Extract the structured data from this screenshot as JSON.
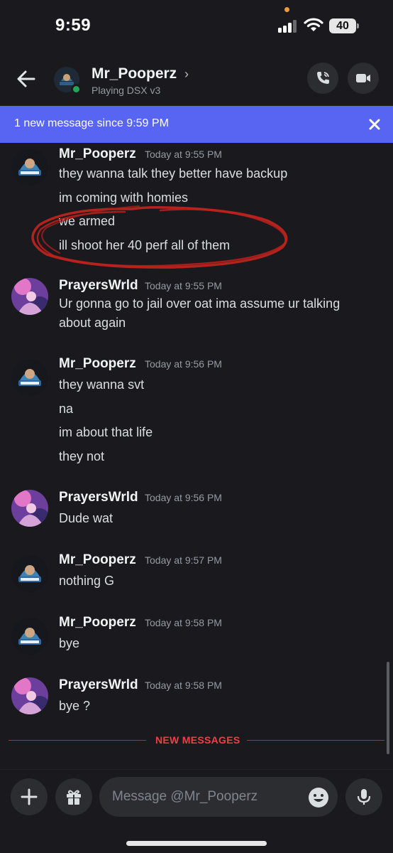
{
  "status_bar": {
    "time": "9:59",
    "battery": "40"
  },
  "header": {
    "name": "Mr_Pooperz",
    "chevron": "›",
    "status": "Playing DSX v3"
  },
  "banner": {
    "text": "1 new message since 9:59 PM",
    "close_icon": "close-icon"
  },
  "messages": [
    {
      "author": "Mr_Pooperz",
      "time": "Today at 9:55 PM",
      "lines": [
        "they wanna talk they better have backup",
        "im coming with homies",
        "we armed",
        "ill shoot her 40 perf all of them"
      ]
    },
    {
      "author": "PrayersWrld",
      "time": "Today at 9:55 PM",
      "lines": [
        "Ur gonna go to jail over oat ima assume ur talking about again"
      ]
    },
    {
      "author": "Mr_Pooperz",
      "time": "Today at 9:56 PM",
      "lines": [
        "they wanna svt",
        "na",
        "im about that life",
        "they not"
      ]
    },
    {
      "author": "PrayersWrld",
      "time": "Today at 9:56 PM",
      "lines": [
        "Dude wat"
      ]
    },
    {
      "author": "Mr_Pooperz",
      "time": "Today at 9:57 PM",
      "lines": [
        "nothing G"
      ]
    },
    {
      "author": "Mr_Pooperz",
      "time": "Today at 9:58 PM",
      "lines": [
        "bye"
      ]
    },
    {
      "author": "PrayersWrld",
      "time": "Today at 9:58 PM",
      "lines": [
        "bye ?"
      ]
    }
  ],
  "divider": {
    "label": "NEW MESSAGES"
  },
  "composer": {
    "placeholder": "Message @Mr_Pooperz"
  },
  "colors": {
    "accent": "#5865f2",
    "online": "#23a55a",
    "new_messages": "#f23f43",
    "annotation": "#c0201c"
  }
}
